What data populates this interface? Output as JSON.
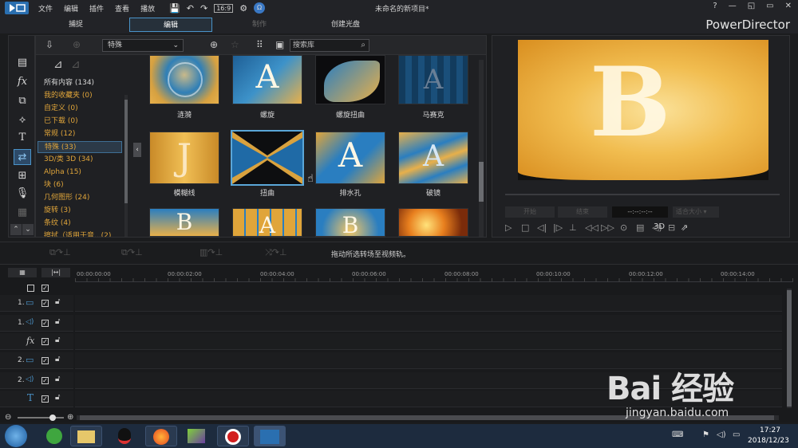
{
  "menu": {
    "items": [
      "文件",
      "编辑",
      "插件",
      "查看",
      "播放"
    ]
  },
  "project_title": "未命名的新项目*",
  "window_buttons": [
    "?",
    "—",
    "◱",
    "▭",
    "✕"
  ],
  "modes": {
    "capture": "捕捉",
    "edit": "编辑",
    "produce": "制作",
    "disc": "创建光盘"
  },
  "brand": "PowerDirector",
  "library": {
    "category_select": "特殊",
    "search_placeholder": "搜索库",
    "categories": [
      {
        "label": "所有内容 (134)",
        "color": "#d6d6d6"
      },
      {
        "label": "我的收藏夹 (0)",
        "color": "#e0a53a"
      },
      {
        "label": "自定义 (0)",
        "color": "#e0a53a"
      },
      {
        "label": "已下载 (0)",
        "color": "#e0a53a"
      },
      {
        "label": "常规 (12)",
        "color": "#e0a53a"
      },
      {
        "label": "特殊 (33)",
        "color": "#e0a53a"
      },
      {
        "label": "3D/类 3D (34)",
        "color": "#e0a53a"
      },
      {
        "label": "Alpha (15)",
        "color": "#e0a53a"
      },
      {
        "label": "块 (6)",
        "color": "#e0a53a"
      },
      {
        "label": "几何图形 (24)",
        "color": "#e0a53a"
      },
      {
        "label": "旋转 (3)",
        "color": "#e0a53a"
      },
      {
        "label": "条纹 (4)",
        "color": "#e0a53a"
      },
      {
        "label": "擦拭（适用于音...(2)",
        "color": "#e0a53a"
      }
    ],
    "thumbnails_row1": [
      "涟漪",
      "螺旋",
      "螺旋扭曲",
      "马赛克"
    ],
    "thumbnails_row2": [
      "模糊线",
      "扭曲",
      "排水孔",
      "破镜"
    ]
  },
  "preview": {
    "letter": "B",
    "btn_start": "开始",
    "btn_end": "结束",
    "timecode": "--:--:--:--",
    "fit": "适合大小",
    "mode_3d": "3D"
  },
  "timeline": {
    "hint": "拖动所选转场至视频轨。",
    "ticks": [
      "00:00:00:00",
      "00:00:02:00",
      "00:00:04:00",
      "00:00:06:00",
      "00:00:08:00",
      "00:00:10:00",
      "00:00:12:00",
      "00:00:14:00"
    ],
    "tracks": [
      {
        "num": "1.",
        "icon": "▭"
      },
      {
        "num": "1.",
        "icon": "◁)"
      },
      {
        "num": "",
        "icon": "fx"
      },
      {
        "num": "2.",
        "icon": "▭"
      },
      {
        "num": "2.",
        "icon": "◁)"
      },
      {
        "num": "",
        "icon": "T"
      }
    ]
  },
  "taskbar": {
    "time": "17:27",
    "date": "2018/12/23"
  },
  "watermark": {
    "brand": "Bai 经验",
    "url": "jingyan.baidu.com"
  }
}
